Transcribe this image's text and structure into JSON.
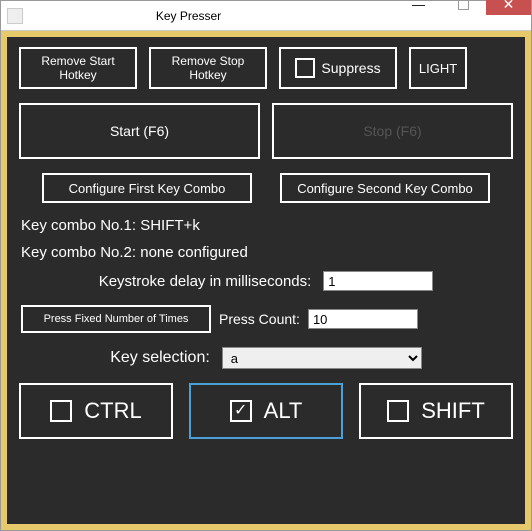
{
  "titlebar": {
    "title": "Key Presser"
  },
  "top": {
    "remove_start": "Remove Start\nHotkey",
    "remove_stop": "Remove Stop\nHotkey",
    "suppress": "Suppress",
    "light": "LIGHT"
  },
  "actions": {
    "start": "Start (F6)",
    "stop": "Stop (F6)"
  },
  "configure": {
    "first": "Configure First Key Combo",
    "second": "Configure Second Key Combo"
  },
  "combos": {
    "line1": "Key combo No.1: SHIFT+k",
    "line2": "Key combo No.2: none configured"
  },
  "delay": {
    "label": "Keystroke delay in milliseconds:",
    "value": "1"
  },
  "press": {
    "fixed_btn": "Press Fixed Number of Times",
    "count_label": "Press Count:",
    "count_value": "10"
  },
  "keyselect": {
    "label": "Key selection:",
    "value": "a"
  },
  "modifiers": {
    "ctrl": {
      "label": "CTRL",
      "checked": false
    },
    "alt": {
      "label": "ALT",
      "checked": true
    },
    "shift": {
      "label": "SHIFT",
      "checked": false
    }
  }
}
